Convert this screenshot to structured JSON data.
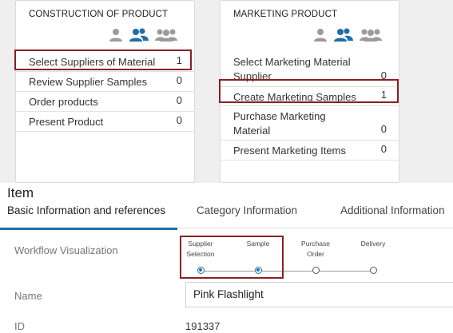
{
  "cards": [
    {
      "title": "CONSTRUCTION OF PRODUCT",
      "tasks": [
        {
          "label": "Select Suppliers of Material",
          "count": "1"
        },
        {
          "label": "Review Supplier Samples",
          "count": "0"
        },
        {
          "label": "Order products",
          "count": "0"
        },
        {
          "label": "Present Product",
          "count": "0"
        }
      ]
    },
    {
      "title": "MARKETING PRODUCT",
      "tasks": [
        {
          "label": "Select Marketing Material Supplier",
          "count": "0"
        },
        {
          "label": "Create Marketing Samples",
          "count": "1"
        },
        {
          "label": "Purchase Marketing Material",
          "count": "0"
        },
        {
          "label": "Present Marketing Items",
          "count": "0"
        }
      ]
    }
  ],
  "item": {
    "title": "Item",
    "tabs": [
      "Basic Information and references",
      "Category Information",
      "Additional Information"
    ],
    "active_tab": 0,
    "workflow_label": "Workflow Visualization",
    "workflow_steps": [
      {
        "line1": "Supplier",
        "line2": "Selection",
        "state": "done"
      },
      {
        "line1": "",
        "line2": "Sample",
        "state": "done"
      },
      {
        "line1": "Purchase",
        "line2": "Order",
        "state": "pending"
      },
      {
        "line1": "",
        "line2": "Delivery",
        "state": "pending"
      }
    ],
    "name_label": "Name",
    "name_value": "Pink Flashlight",
    "id_label": "ID",
    "id_value": "191337"
  },
  "colors": {
    "accent": "#1f6fa8",
    "highlight": "#8b1e24",
    "icon_gray": "#9b9b9b"
  }
}
